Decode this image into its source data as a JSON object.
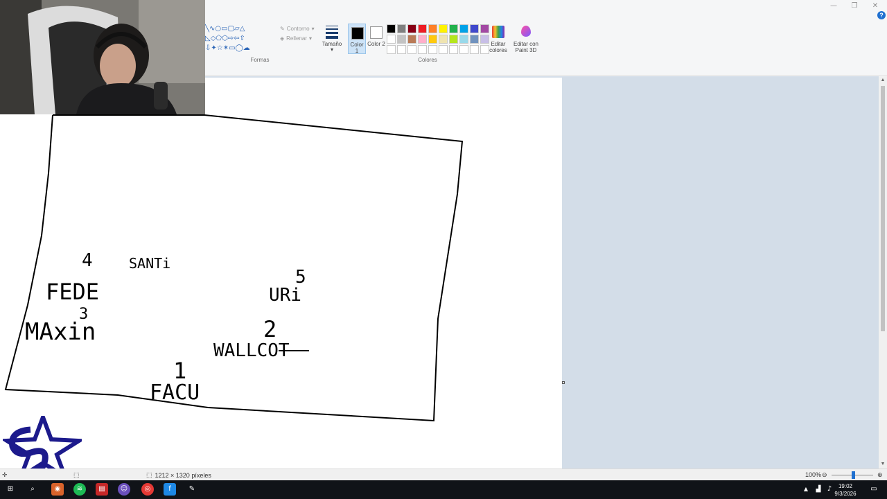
{
  "ribbon": {
    "shapes": {
      "outline_label": "Contorno",
      "fill_label": "Rellenar",
      "group_label": "Formas"
    },
    "size_label": "Tamaño",
    "color1_label": "Color 1",
    "color2_label": "Color 2",
    "colors_group_label": "Colores",
    "edit_colors_label": "Editar colores",
    "paint3d_label": "Editar con Paint 3D",
    "color1_value": "#000000",
    "color2_value": "#ffffff",
    "palette": [
      "#000000",
      "#7f7f7f",
      "#880015",
      "#ed1c24",
      "#ff7f27",
      "#fff200",
      "#22b14c",
      "#00a2e8",
      "#3f48cc",
      "#a349a4",
      "#ffffff",
      "#c3c3c3",
      "#b97a57",
      "#ffaec9",
      "#ffc90e",
      "#efe4b0",
      "#b5e61d",
      "#99d9ea",
      "#7092be",
      "#c8bfe7",
      "#ffffff",
      "#ffffff",
      "#ffffff",
      "#ffffff",
      "#ffffff",
      "#ffffff",
      "#ffffff",
      "#ffffff",
      "#ffffff",
      "#ffffff"
    ]
  },
  "canvas": {
    "labels": [
      {
        "id": "num-4",
        "text": "4"
      },
      {
        "id": "santi",
        "text": "SANTi"
      },
      {
        "id": "fede",
        "text": "FEDE"
      },
      {
        "id": "num-3",
        "text": "3"
      },
      {
        "id": "maxin",
        "text": "MAxin"
      },
      {
        "id": "num-5",
        "text": "5"
      },
      {
        "id": "uri",
        "text": "URi"
      },
      {
        "id": "num-2",
        "text": "2"
      },
      {
        "id": "wallcot",
        "text": "WALLCOT"
      },
      {
        "id": "num-1",
        "text": "1"
      },
      {
        "id": "facu",
        "text": "FACU"
      }
    ]
  },
  "status": {
    "dimensions": "1212 × 1320 píxeles",
    "zoom": "100%"
  },
  "taskbar": {
    "time": "19:02",
    "date": "9/3/2026"
  },
  "colors": {
    "accent": "#1e6fd0",
    "workspace": "#d3dde8"
  }
}
